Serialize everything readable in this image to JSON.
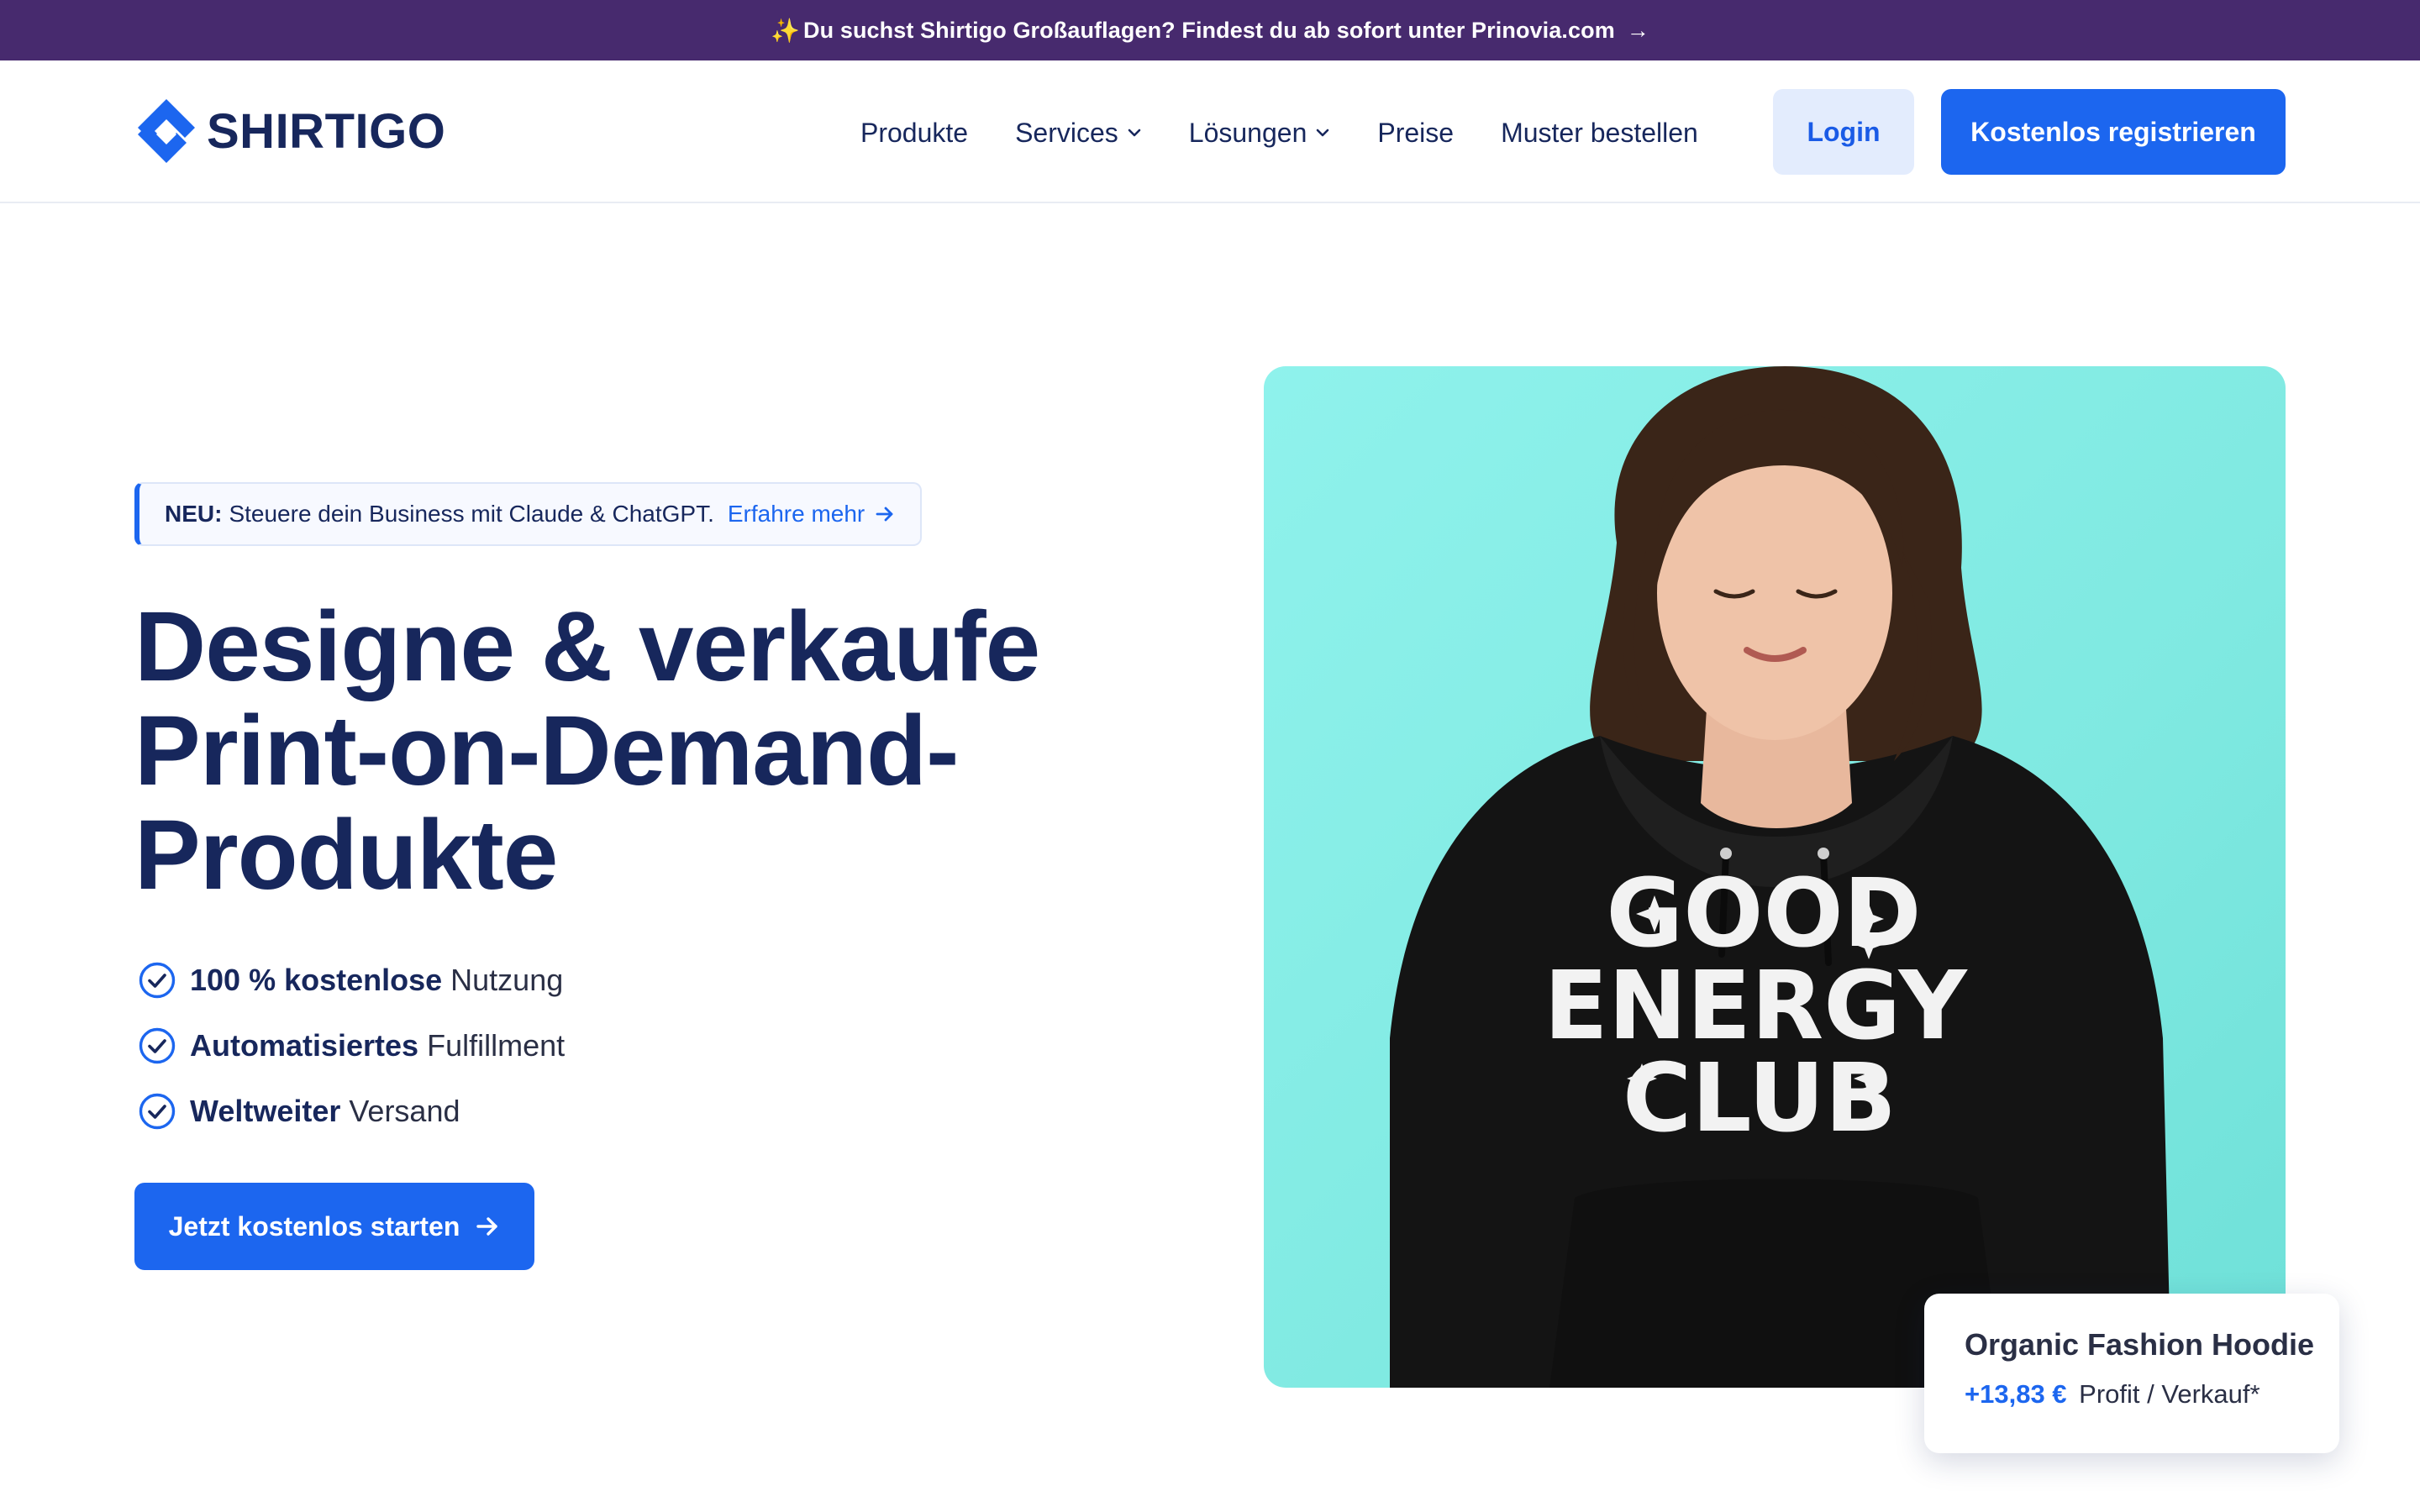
{
  "announcement": {
    "text": "Du suchst Shirtigo Großauflagen? Findest du ab sofort unter Prinovia.com",
    "spark": "✨",
    "arrow": "→"
  },
  "header": {
    "logo_text": "SHIRTIGO",
    "nav": [
      {
        "label": "Produkte",
        "dropdown": false
      },
      {
        "label": "Services",
        "dropdown": true
      },
      {
        "label": "Lösungen",
        "dropdown": true
      },
      {
        "label": "Preise",
        "dropdown": false
      },
      {
        "label": "Muster bestellen",
        "dropdown": false
      }
    ],
    "login_label": "Login",
    "register_label": "Kostenlos registrieren"
  },
  "hero": {
    "pill": {
      "badge": "NEU:",
      "text": "Steuere dein Business mit Claude & ChatGPT.",
      "link": "Erfahre mehr"
    },
    "title_lines": [
      "Designe & verkaufe",
      "Print-on-Demand-",
      "Produkte"
    ],
    "features": [
      {
        "bold": "100 % kostenlose",
        "rest": "Nutzung"
      },
      {
        "bold": "Automatisiertes",
        "rest": "Fulfillment"
      },
      {
        "bold": "Weltweiter",
        "rest": "Versand"
      }
    ],
    "cta_label": "Jetzt kostenlos starten",
    "image": {
      "print_lines": [
        "GOOD",
        "ENERGY",
        "CLUB"
      ]
    },
    "product_card": {
      "title": "Organic Fashion Hoodie",
      "profit": "+13,83 €",
      "profit_suffix": "Profit / Verkauf*"
    }
  },
  "colors": {
    "announcement_bg": "#472a6e",
    "primary": "#1c66ef",
    "navy": "#17275c",
    "hero_bg": "#8ff2ec"
  }
}
